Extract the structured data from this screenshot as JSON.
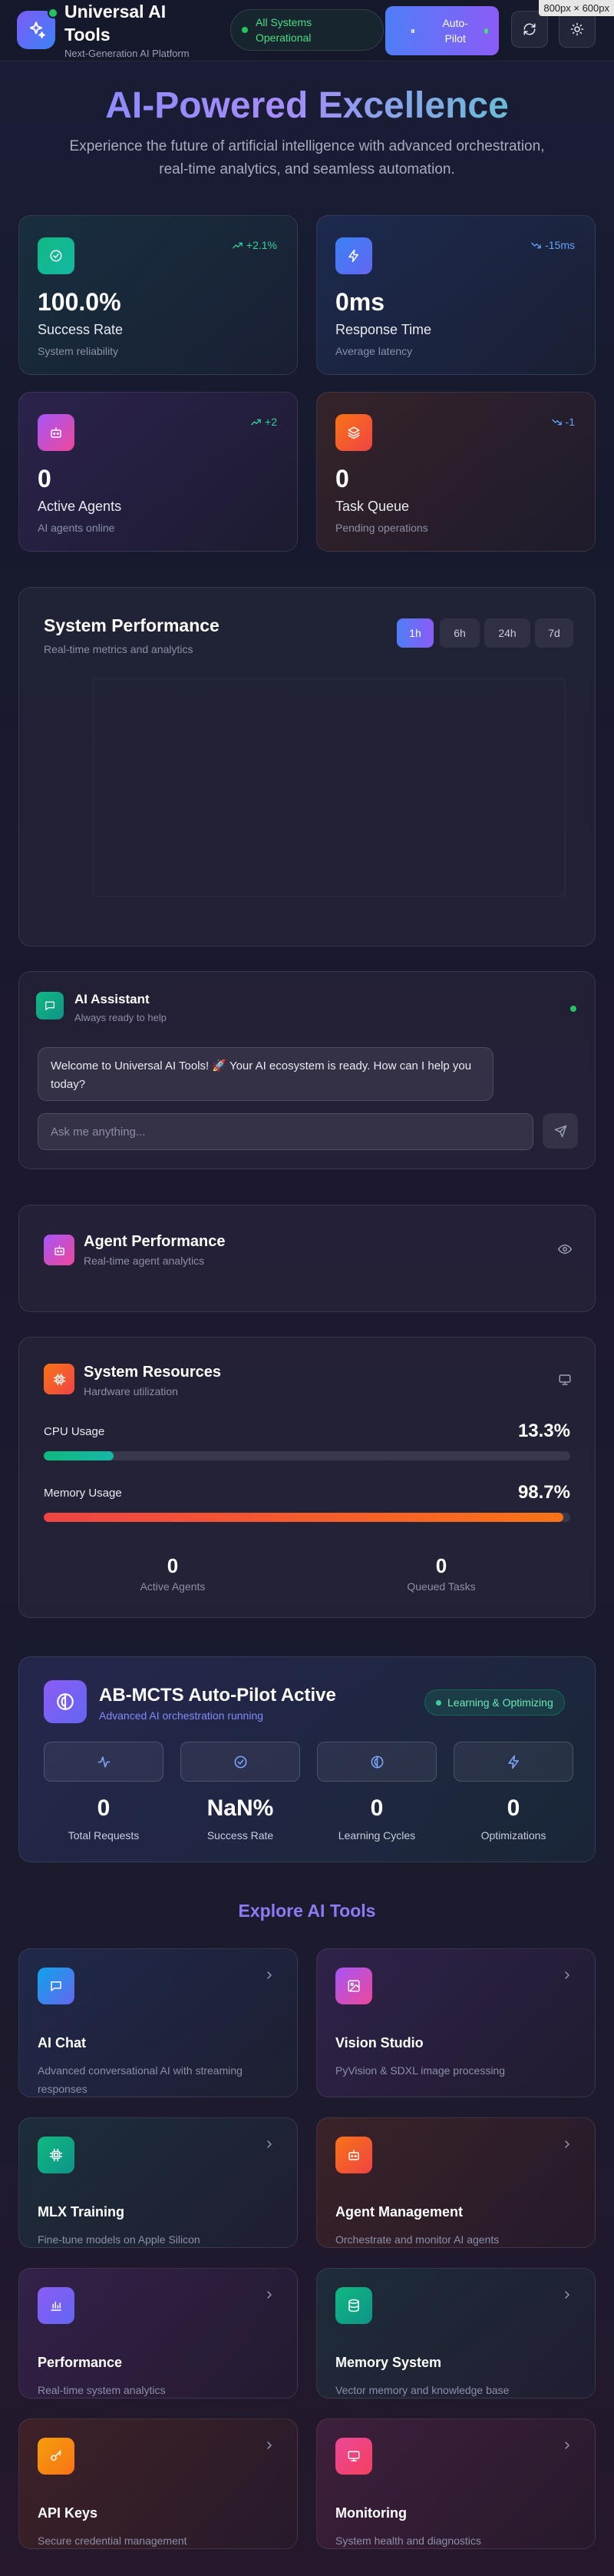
{
  "header": {
    "title": "Universal AI Tools",
    "subtitle": "Next-Generation AI Platform",
    "status": "All Systems Operational",
    "autopilot_label": "Auto-Pilot",
    "screen_size_badge": "800px × 600px"
  },
  "hero": {
    "title": "AI-Powered Excellence",
    "subtitle": "Experience the future of artificial intelligence with advanced orchestration, real-time analytics, and seamless automation."
  },
  "metrics": [
    {
      "value": "100.0%",
      "label": "Success Rate",
      "sub": "System reliability",
      "trend": "+2.1%",
      "trend_color": "#34d399",
      "icon": "check-circle-icon"
    },
    {
      "value": "0ms",
      "label": "Response Time",
      "sub": "Average latency",
      "trend": "-15ms",
      "trend_color": "#60a5fa",
      "icon": "lightning-icon"
    },
    {
      "value": "0",
      "label": "Active Agents",
      "sub": "AI agents online",
      "trend": "+2",
      "trend_color": "#34d399",
      "icon": "robot-icon"
    },
    {
      "value": "0",
      "label": "Task Queue",
      "sub": "Pending operations",
      "trend": "-1",
      "trend_color": "#60a5fa",
      "icon": "layers-icon"
    }
  ],
  "performance": {
    "title": "System Performance",
    "subtitle": "Real-time metrics and analytics",
    "ranges": [
      "1h",
      "6h",
      "24h",
      "7d"
    ],
    "active_range": "1h"
  },
  "assistant": {
    "title": "AI Assistant",
    "subtitle": "Always ready to help",
    "welcome": "Welcome to Universal AI Tools! 🚀 Your AI ecosystem is ready. How can I help you today?",
    "placeholder": "Ask me anything..."
  },
  "agent_performance": {
    "title": "Agent Performance",
    "subtitle": "Real-time agent analytics"
  },
  "resources": {
    "title": "System Resources",
    "subtitle": "Hardware utilization",
    "cpu_label": "CPU Usage",
    "cpu_value": "13.3%",
    "cpu_fraction": 0.133,
    "mem_label": "Memory Usage",
    "mem_value": "98.7%",
    "mem_fraction": 0.987,
    "active_agents": "0",
    "active_agents_label": "Active Agents",
    "queued_tasks": "0",
    "queued_tasks_label": "Queued Tasks"
  },
  "autopilot": {
    "title": "AB-MCTS Auto-Pilot Active",
    "subtitle": "Advanced AI orchestration running",
    "badge": "Learning & Optimizing",
    "stats": [
      {
        "value": "0",
        "label": "Total Requests",
        "icon": "activity-icon"
      },
      {
        "value": "NaN%",
        "label": "Success Rate",
        "icon": "check-circle-icon"
      },
      {
        "value": "0",
        "label": "Learning Cycles",
        "icon": "brain-icon"
      },
      {
        "value": "0",
        "label": "Optimizations",
        "icon": "lightning-icon"
      }
    ]
  },
  "tools": {
    "heading": "Explore AI Tools",
    "items": [
      {
        "title": "AI Chat",
        "desc": "Advanced conversational AI with streaming responses",
        "icon": "chat-icon"
      },
      {
        "title": "Vision Studio",
        "desc": "PyVision & SDXL image processing",
        "icon": "image-icon"
      },
      {
        "title": "MLX Training",
        "desc": "Fine-tune models on Apple Silicon",
        "icon": "cpu-icon"
      },
      {
        "title": "Agent Management",
        "desc": "Orchestrate and monitor AI agents",
        "icon": "robot-icon"
      },
      {
        "title": "Performance",
        "desc": "Real-time system analytics",
        "icon": "bar-chart-icon"
      },
      {
        "title": "Memory System",
        "desc": "Vector memory and knowledge base",
        "icon": "database-icon"
      },
      {
        "title": "API Keys",
        "desc": "Secure credential management",
        "icon": "key-icon"
      },
      {
        "title": "Monitoring",
        "desc": "System health and diagnostics",
        "icon": "monitor-icon"
      }
    ]
  }
}
